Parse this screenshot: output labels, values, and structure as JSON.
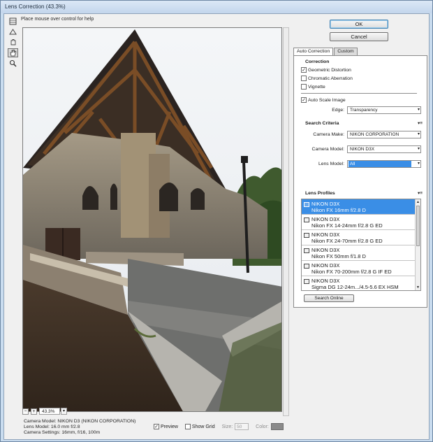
{
  "window": {
    "title": "Lens Correction (43.3%)"
  },
  "help_text": "Place mouse over control for help",
  "tools": [
    {
      "icon": "remove-distortion-tool-icon",
      "active": false
    },
    {
      "icon": "straighten-tool-icon",
      "active": false
    },
    {
      "icon": "move-grid-tool-icon",
      "active": false
    },
    {
      "icon": "hand-tool-icon",
      "active": true
    },
    {
      "icon": "zoom-tool-icon",
      "active": false
    }
  ],
  "buttons": {
    "ok": "OK",
    "cancel": "Cancel",
    "search_online": "Search Online"
  },
  "tabs": [
    {
      "label": "Auto Correction",
      "active": true
    },
    {
      "label": "Custom",
      "active": false
    }
  ],
  "correction": {
    "heading": "Correction",
    "geometric_distortion": {
      "label": "Geometric Distortion",
      "checked": true
    },
    "chromatic_aberration": {
      "label": "Chromatic Aberration",
      "checked": false
    },
    "vignette": {
      "label": "Vignette",
      "checked": false
    },
    "auto_scale": {
      "label": "Auto Scale Image",
      "checked": true
    },
    "edge_label": "Edge:",
    "edge_value": "Transparency"
  },
  "search_criteria": {
    "heading": "Search Criteria",
    "camera_make_label": "Camera Make:",
    "camera_make_value": "NIKON CORPORATION",
    "camera_model_label": "Camera Model:",
    "camera_model_value": "NIKON D3X",
    "lens_model_label": "Lens Model:",
    "lens_model_value": "All"
  },
  "lens_profiles": {
    "heading": "Lens Profiles",
    "items": [
      {
        "camera": "NIKON D3X",
        "lens": "Nikon FX 16mm f/2.8 D"
      },
      {
        "camera": "NIKON D3X",
        "lens": "Nikon FX 14-24mm f/2.8 G ED"
      },
      {
        "camera": "NIKON D3X",
        "lens": "Nikon FX 24-70mm f/2.8 G ED"
      },
      {
        "camera": "NIKON D3X",
        "lens": "Nikon FX 50mm f/1.8 D"
      },
      {
        "camera": "NIKON D3X",
        "lens": "Nikon FX 70-200mm f/2.8 G IF ED"
      },
      {
        "camera": "NIKON D3X",
        "lens": "Sigma DG 12-24m.../4.5-5.6 EX HSM"
      }
    ]
  },
  "zoom": {
    "value": "43.3%",
    "minus": "−",
    "plus": "+"
  },
  "info": {
    "camera_model": "Camera Model: NIKON D3 (NIKON CORPORATION)",
    "lens_model": "Lens Model: 16.0 mm f/2.8",
    "camera_settings": "Camera Settings: 16mm, f/16, 100m"
  },
  "view_options": {
    "preview": {
      "label": "Preview",
      "checked": true
    },
    "show_grid": {
      "label": "Show Grid",
      "checked": false
    },
    "size_label": "Size:",
    "size_value": "50",
    "color_label": "Color:"
  },
  "colors": {
    "selection": "#3a8ee6",
    "grid_color_swatch": "#8a8a8a"
  }
}
